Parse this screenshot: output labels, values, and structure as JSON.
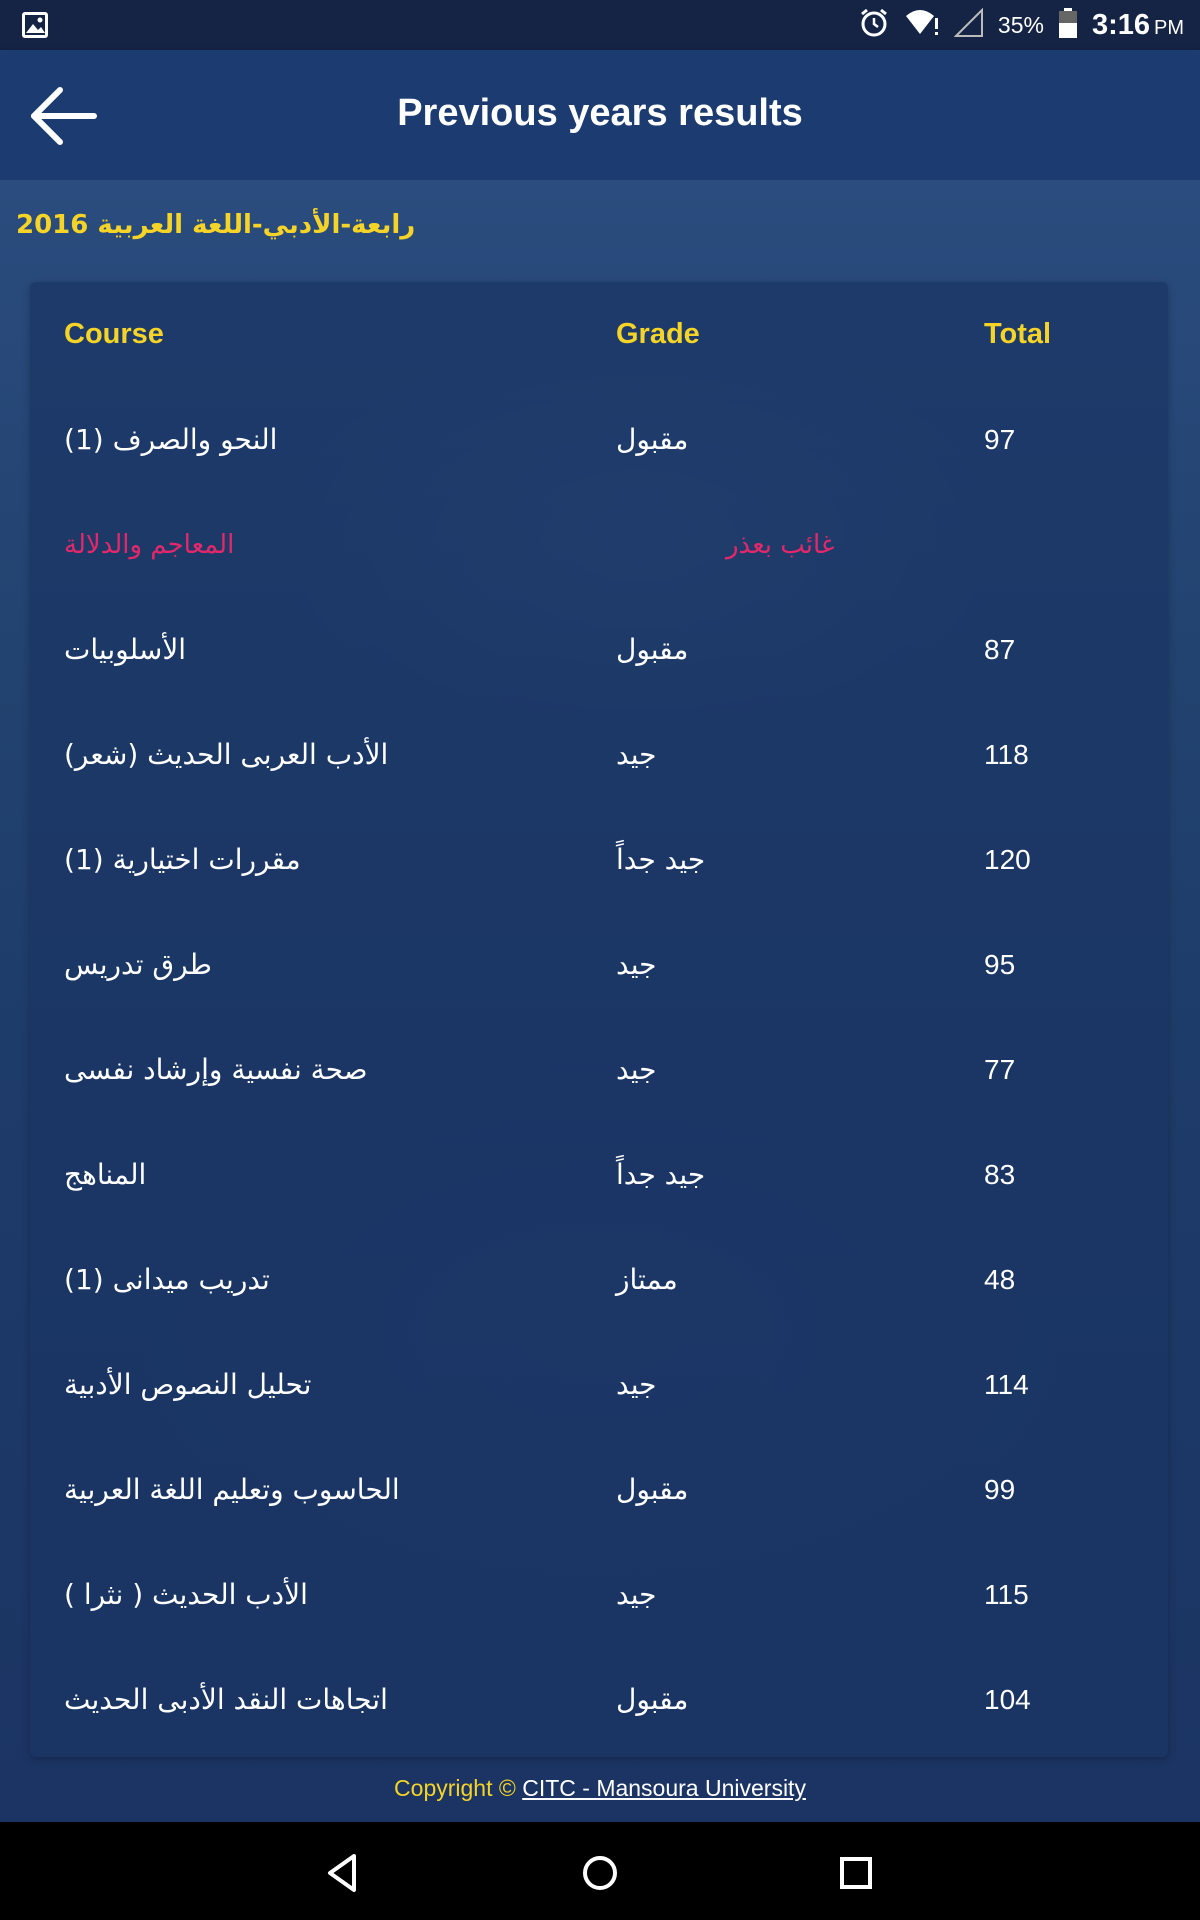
{
  "status_bar": {
    "battery_percent": "35%",
    "time": "3:16",
    "ampm": "PM",
    "icons": [
      "image-notification-icon",
      "alarm-icon",
      "wifi-icon",
      "signal-icon",
      "battery-icon"
    ]
  },
  "app_bar": {
    "title": "Previous years results",
    "back_icon": "arrow-left-icon"
  },
  "section": {
    "title": "رابعة-الأدبي-اللغة العربية 2016"
  },
  "table": {
    "headers": {
      "course": "Course",
      "grade": "Grade",
      "total": "Total"
    },
    "rows": [
      {
        "course": "النحو والصرف (1)",
        "grade": "مقبول",
        "total": "97"
      },
      {
        "course": "المعاجم والدلالة",
        "grade": "غائب بعذر",
        "total": ""
      },
      {
        "course": "الأسلوبيات",
        "grade": "مقبول",
        "total": "87"
      },
      {
        "course": "الأدب العربى الحديث (شعر)",
        "grade": "جيد",
        "total": "118"
      },
      {
        "course": "مقررات اختيارية (1)",
        "grade": "جيد جداً",
        "total": "120"
      },
      {
        "course": "طرق تدريس",
        "grade": "جيد",
        "total": "95"
      },
      {
        "course": "صحة نفسية وإرشاد نفسى",
        "grade": "جيد",
        "total": "77"
      },
      {
        "course": "المناهج",
        "grade": "جيد جداً",
        "total": "83"
      },
      {
        "course": "تدريب ميدانى (1)",
        "grade": "ممتاز",
        "total": "48"
      },
      {
        "course": "تحليل النصوص الأدبية",
        "grade": "جيد",
        "total": "114"
      },
      {
        "course": "الحاسوب وتعليم اللغة العربية",
        "grade": "مقبول",
        "total": "99"
      },
      {
        "course": "الأدب الحديث ( نثرا )",
        "grade": "جيد",
        "total": "115"
      },
      {
        "course": "اتجاهات النقد الأدبى الحديث",
        "grade": "مقبول",
        "total": "104"
      }
    ]
  },
  "footer": {
    "prefix": "Copyright © ",
    "link_text": "CITC - Mansoura University"
  },
  "nav_bar": {
    "icons": [
      "back-triangle-icon",
      "home-circle-icon",
      "recents-square-icon"
    ]
  },
  "colors": {
    "accent_yellow": "#f5d327",
    "excused_pink": "#e2286b",
    "app_bar": "#1c3b70",
    "status_bar": "#152444"
  }
}
